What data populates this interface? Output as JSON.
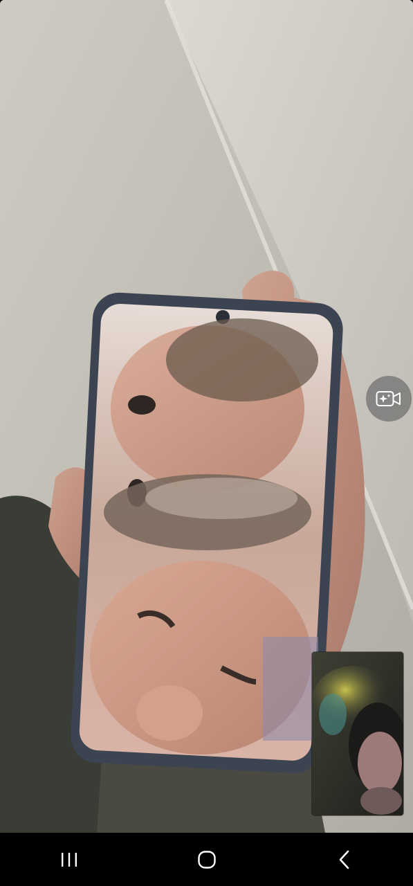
{
  "screen": {
    "type": "video-call",
    "remote_video": {
      "description_icon": "remote-video-feed"
    },
    "effects_button": {
      "icon": "video-effects-sparkle-icon"
    },
    "self_view": {
      "icon": "self-camera-preview"
    }
  },
  "nav_bar": {
    "recents_icon": "recent-apps-icon",
    "home_icon": "home-icon",
    "back_icon": "back-icon",
    "color": "#ffffff"
  },
  "colors": {
    "background": "#000000",
    "effects_button_bg": "#6e6e6e"
  }
}
